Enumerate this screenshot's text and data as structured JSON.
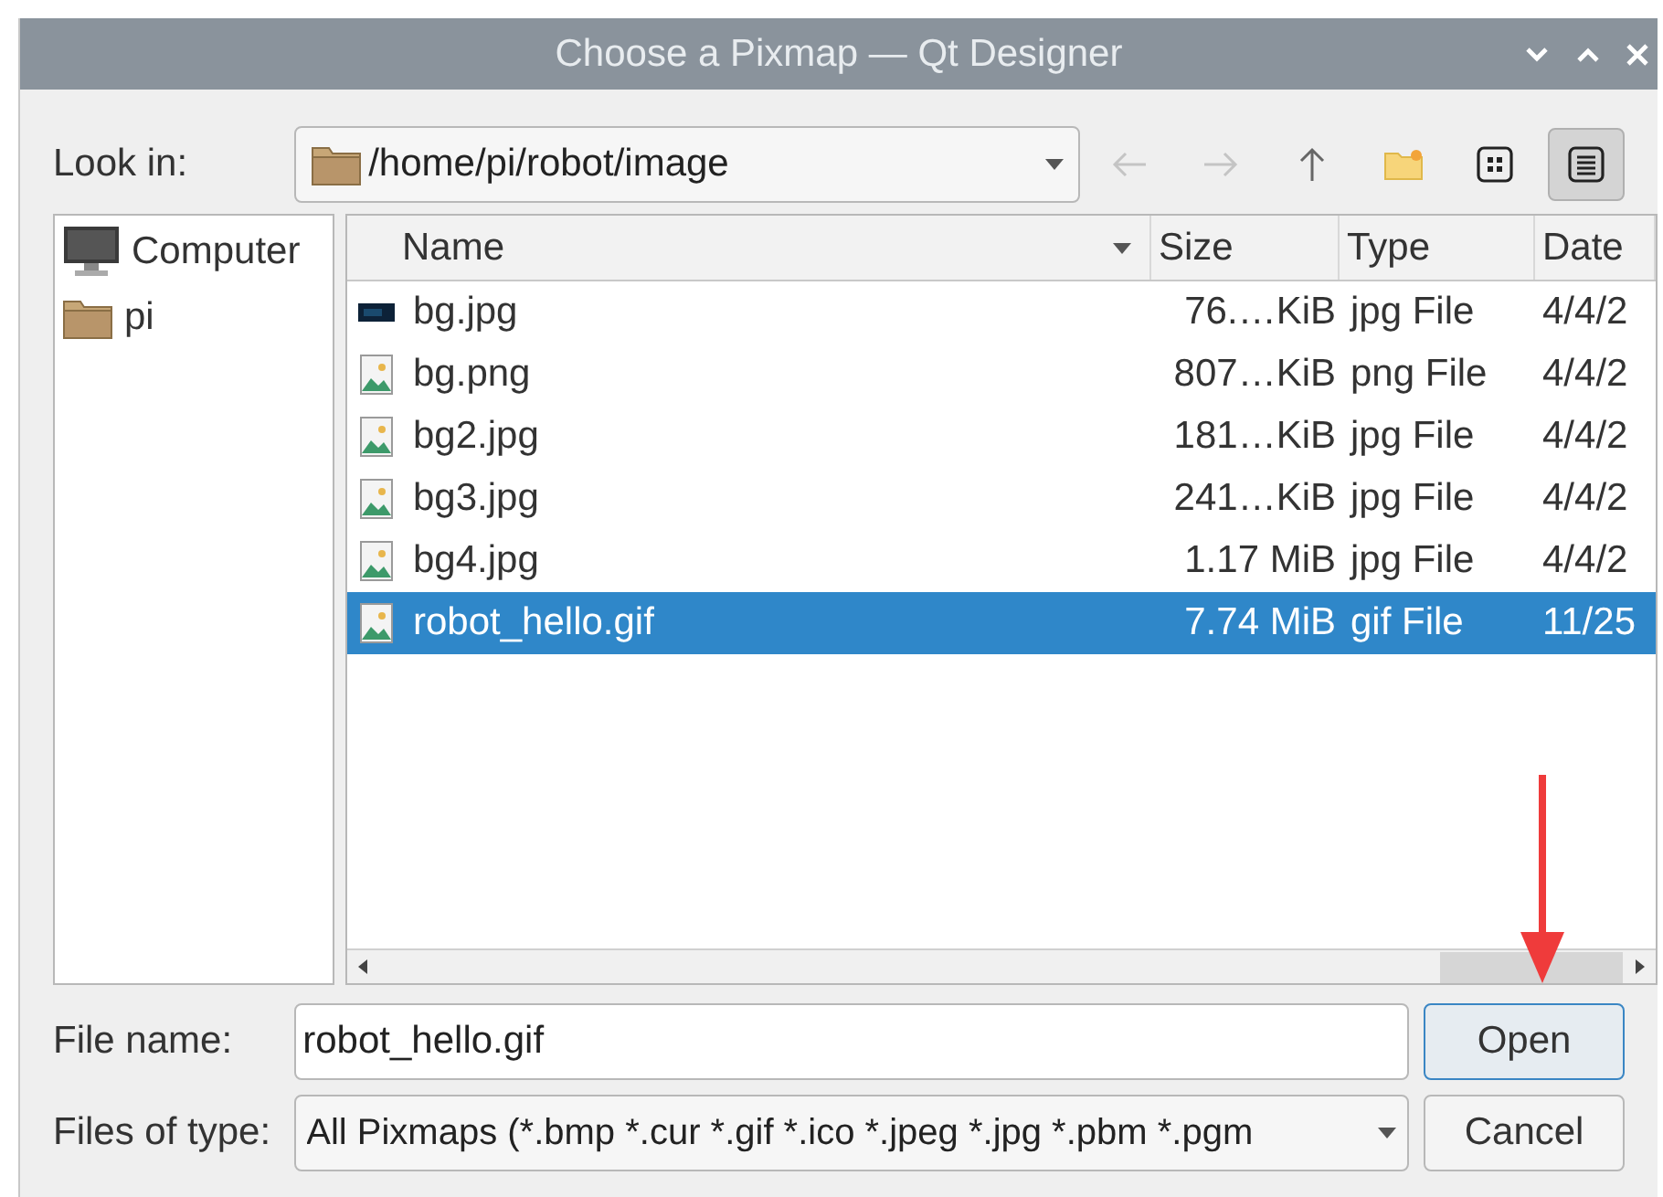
{
  "window": {
    "title": "Choose a Pixmap — Qt Designer"
  },
  "look_in": {
    "label": "Look in:",
    "value": "/home/pi/robot/image"
  },
  "toolbar": [
    {
      "kind": "back",
      "disabled": true
    },
    {
      "kind": "forward",
      "disabled": true
    },
    {
      "kind": "up",
      "disabled": false
    },
    {
      "kind": "new-folder"
    },
    {
      "kind": "icon-view",
      "selected": false
    },
    {
      "kind": "detail-view",
      "selected": true
    }
  ],
  "sidebar": {
    "items": [
      {
        "label": "Computer",
        "kind": "computer",
        "selected": false
      },
      {
        "label": "pi",
        "kind": "folder",
        "selected": false
      }
    ]
  },
  "table": {
    "columns": [
      "Name",
      "Size",
      "Type",
      "Date"
    ],
    "rows": [
      {
        "name": "bg.jpg",
        "size": "76.…KiB",
        "type": "jpg File",
        "date": "4/4/2",
        "kind": "dark",
        "selected": false
      },
      {
        "name": "bg.png",
        "size": "807…KiB",
        "type": "png File",
        "date": "4/4/2",
        "kind": "image",
        "selected": false
      },
      {
        "name": "bg2.jpg",
        "size": "181…KiB",
        "type": "jpg File",
        "date": "4/4/2",
        "kind": "image",
        "selected": false
      },
      {
        "name": "bg3.jpg",
        "size": "241…KiB",
        "type": "jpg File",
        "date": "4/4/2",
        "kind": "image",
        "selected": false
      },
      {
        "name": "bg4.jpg",
        "size": "1.17 MiB",
        "type": "jpg File",
        "date": "4/4/2",
        "kind": "image",
        "selected": false
      },
      {
        "name": "robot_hello.gif",
        "size": "7.74 MiB",
        "type": "gif File",
        "date": "11/25",
        "kind": "image",
        "selected": true
      }
    ]
  },
  "file_name": {
    "label": "File name:",
    "value": "robot_hello.gif"
  },
  "file_type": {
    "label": "Files of type:",
    "value": "All Pixmaps (*.bmp *.cur *.gif *.ico *.jpeg *.jpg *.pbm *.pgm"
  },
  "buttons": [
    {
      "label": "Open",
      "default": true
    },
    {
      "label": "Cancel",
      "default": false
    }
  ]
}
